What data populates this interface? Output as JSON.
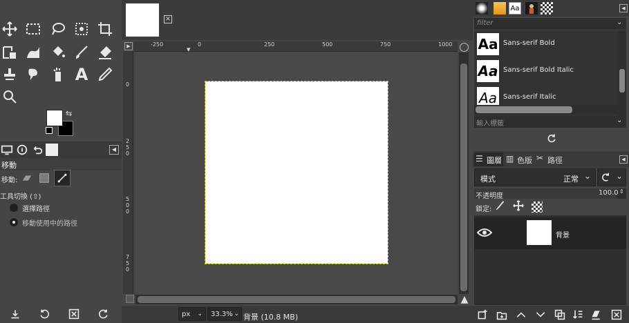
{
  "toolbox": {
    "tools": [
      {
        "icon": "move-tool-icon"
      },
      {
        "icon": "rect-select-icon"
      },
      {
        "icon": "lasso-icon"
      },
      {
        "icon": "fuzzy-select-icon"
      },
      {
        "icon": "crop-icon"
      },
      {
        "icon": "transform-icon"
      },
      {
        "icon": "warp-icon"
      },
      {
        "icon": "bucket-fill-icon"
      },
      {
        "icon": "paintbrush-icon"
      },
      {
        "icon": "eraser-icon"
      },
      {
        "icon": "clone-icon"
      },
      {
        "icon": "smudge-icon"
      },
      {
        "icon": "dodge-icon"
      },
      {
        "icon": "text-icon",
        "glyph": "A"
      },
      {
        "icon": "color-picker-icon"
      },
      {
        "icon": "zoom-icon"
      }
    ],
    "fg_color": "#ffffff",
    "bg_color": "#000000"
  },
  "tool_options": {
    "title": "移動",
    "move_label": "移動:",
    "toggle_label": "工具切換 (⇧)",
    "options": [
      {
        "label": "選擇路徑",
        "selected": false
      },
      {
        "label": "移動使用中的路徑",
        "selected": true
      }
    ]
  },
  "canvas": {
    "ruler_h": [
      "-250",
      "0",
      "250",
      "500",
      "750",
      "1000"
    ],
    "ruler_v": [
      "0",
      "2\n5\n0",
      "5\n0\n0",
      "7\n5\n0"
    ],
    "unit": "px",
    "zoom": "33.3%",
    "status": "背景 (10.8 MB)"
  },
  "fonts": {
    "filter_placeholder": "filter",
    "items": [
      {
        "name": "Sans-serif Bold",
        "sample": "Aa"
      },
      {
        "name": "Sans-serif Bold Italic",
        "sample": "Aa"
      },
      {
        "name": "Sans-serif Italic",
        "sample": "Aa"
      }
    ],
    "tag_placeholder": "輸入標籤"
  },
  "layers": {
    "tabs": [
      {
        "label": "圖層"
      },
      {
        "label": "色版"
      },
      {
        "label": "路徑"
      }
    ],
    "mode_label": "模式",
    "mode_value": "正常",
    "opacity_label": "不透明度",
    "opacity_value": "100.0",
    "lock_label": "鎖定:",
    "items": [
      {
        "name": "背景",
        "visible": true
      }
    ]
  }
}
